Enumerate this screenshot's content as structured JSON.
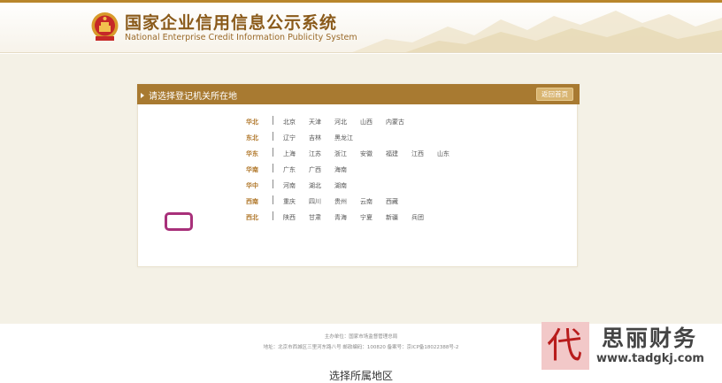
{
  "header": {
    "title": "国家企业信用信息公示系统",
    "subtitle": "National Enterprise Credit Information Publicity System"
  },
  "panel": {
    "title": "请选择登记机关所在地",
    "back_label": "返回首页"
  },
  "regions": [
    {
      "name": "华北",
      "provinces": [
        "北京",
        "天津",
        "河北",
        "山西",
        "内蒙古"
      ]
    },
    {
      "name": "东北",
      "provinces": [
        "辽宁",
        "吉林",
        "黑龙江"
      ]
    },
    {
      "name": "华东",
      "provinces": [
        "上海",
        "江苏",
        "浙江",
        "安徽",
        "福建",
        "江西",
        "山东"
      ]
    },
    {
      "name": "华南",
      "provinces": [
        "广东",
        "广西",
        "海南"
      ]
    },
    {
      "name": "华中",
      "provinces": [
        "河南",
        "湖北",
        "湖南"
      ]
    },
    {
      "name": "西南",
      "provinces": [
        "重庆",
        "四川",
        "贵州",
        "云南",
        "西藏"
      ]
    },
    {
      "name": "西北",
      "provinces": [
        "陕西",
        "甘肃",
        "青海",
        "宁夏",
        "新疆",
        "兵团"
      ]
    }
  ],
  "selected_province": "四川",
  "footer": {
    "line1": "主办单位：国家市场监督管理总局",
    "line2": "地址：北京市西城区三里河东路八号   邮政编码：100820   备案号：京ICP备18022388号-2"
  },
  "caption": "选择所属地区",
  "watermark": {
    "seal_char": "代",
    "name": "思丽财务",
    "url": "www.tadgkj.com"
  },
  "colors": {
    "accent": "#a87a31",
    "region_label": "#b0772a",
    "highlight": "#a8307a",
    "background": "#f4f1e6"
  }
}
